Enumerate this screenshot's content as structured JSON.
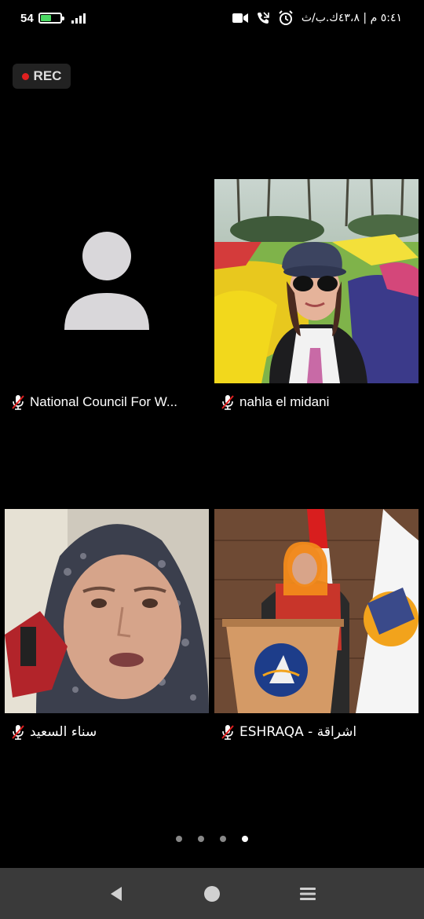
{
  "status_bar": {
    "battery_level": "54",
    "battery_percent": 54,
    "battery_color": "#4cd964",
    "time": "٥:٤١ م | ٤٣،٨ك.ب/ث",
    "icons": [
      "video-icon",
      "missed-call-icon",
      "alarm-icon",
      "signal-icon",
      "battery-icon"
    ]
  },
  "recording": {
    "label": "REC",
    "dot_color": "#e02020"
  },
  "participants": [
    {
      "name": "National Council For W...",
      "video": "avatar-placeholder",
      "muted": true
    },
    {
      "name": "nahla el midani",
      "video": "camera-feed",
      "muted": true
    },
    {
      "name": "سناء السعيد",
      "video": "camera-feed",
      "muted": true
    },
    {
      "name": "ESHRAQA - اشراقة",
      "video": "camera-feed",
      "muted": true
    }
  ],
  "pagination": {
    "total_pages": 4,
    "active_page": 4
  },
  "navigation": {
    "icons": [
      "back-icon",
      "home-icon",
      "recents-menu-icon"
    ]
  },
  "colors": {
    "background": "#000000",
    "nav_bar": "#3a3a3a",
    "mute_icon": "#e02020",
    "avatar": "#d9d7da"
  }
}
